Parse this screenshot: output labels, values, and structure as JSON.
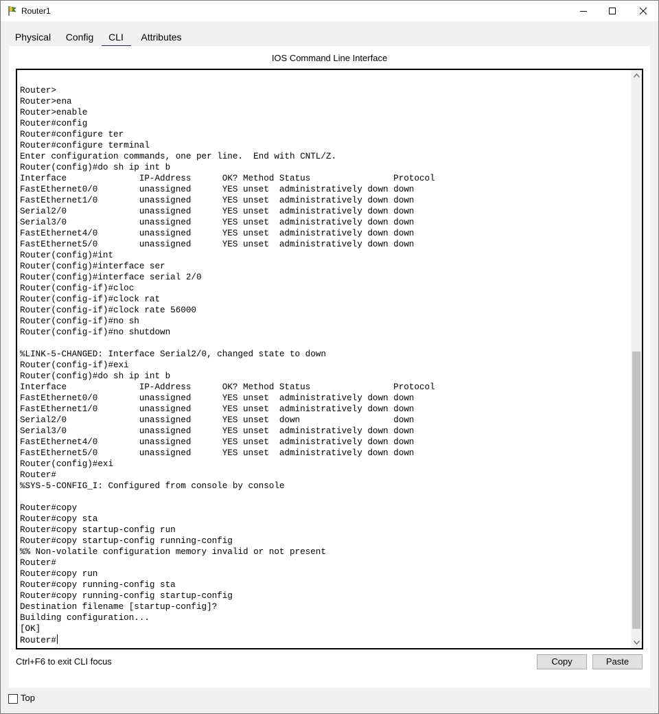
{
  "window": {
    "title": "Router1",
    "app_icon": "packet-tracer-router-icon"
  },
  "tabs": [
    {
      "label": "Physical",
      "active": false
    },
    {
      "label": "Config",
      "active": false
    },
    {
      "label": "CLI",
      "active": true
    },
    {
      "label": "Attributes",
      "active": false
    }
  ],
  "panel": {
    "title": "IOS Command Line Interface"
  },
  "terminal": {
    "lines": [
      "Router>",
      "Router>ena",
      "Router>enable",
      "Router#config",
      "Router#configure ter",
      "Router#configure terminal",
      "Enter configuration commands, one per line.  End with CNTL/Z.",
      "Router(config)#do sh ip int b",
      "Interface              IP-Address      OK? Method Status                Protocol",
      "FastEthernet0/0        unassigned      YES unset  administratively down down",
      "FastEthernet1/0        unassigned      YES unset  administratively down down",
      "Serial2/0              unassigned      YES unset  administratively down down",
      "Serial3/0              unassigned      YES unset  administratively down down",
      "FastEthernet4/0        unassigned      YES unset  administratively down down",
      "FastEthernet5/0        unassigned      YES unset  administratively down down",
      "Router(config)#int",
      "Router(config)#interface ser",
      "Router(config)#interface serial 2/0",
      "Router(config-if)#cloc",
      "Router(config-if)#clock rat",
      "Router(config-if)#clock rate 56000",
      "Router(config-if)#no sh",
      "Router(config-if)#no shutdown",
      "",
      "%LINK-5-CHANGED: Interface Serial2/0, changed state to down",
      "Router(config-if)#exi",
      "Router(config)#do sh ip int b",
      "Interface              IP-Address      OK? Method Status                Protocol",
      "FastEthernet0/0        unassigned      YES unset  administratively down down",
      "FastEthernet1/0        unassigned      YES unset  administratively down down",
      "Serial2/0              unassigned      YES unset  down                  down",
      "Serial3/0              unassigned      YES unset  administratively down down",
      "FastEthernet4/0        unassigned      YES unset  administratively down down",
      "FastEthernet5/0        unassigned      YES unset  administratively down down",
      "Router(config)#exi",
      "Router#",
      "%SYS-5-CONFIG_I: Configured from console by console",
      "",
      "Router#copy",
      "Router#copy sta",
      "Router#copy startup-config run",
      "Router#copy startup-config running-config",
      "%% Non-volatile configuration memory invalid or not present",
      "Router#",
      "Router#copy run",
      "Router#copy running-config sta",
      "Router#copy running-config startup-config",
      "Destination filename [startup-config]?",
      "Building configuration...",
      "[OK]"
    ],
    "prompt": "Router#"
  },
  "footer": {
    "hint": "Ctrl+F6 to exit CLI focus",
    "copy_label": "Copy",
    "paste_label": "Paste"
  },
  "bottom": {
    "top_label": "Top",
    "top_checked": false
  }
}
